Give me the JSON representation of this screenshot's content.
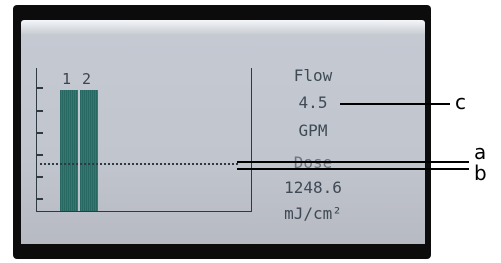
{
  "display": {
    "bar_labels": [
      "1",
      "2"
    ],
    "flow_label": "Flow",
    "flow_value": "4.5",
    "flow_unit": "GPM",
    "dose_label": "Dose",
    "dose_value": "1248.6",
    "dose_unit": "mJ/cm²"
  },
  "callouts": {
    "a": "a",
    "b": "b",
    "c": "c"
  }
}
